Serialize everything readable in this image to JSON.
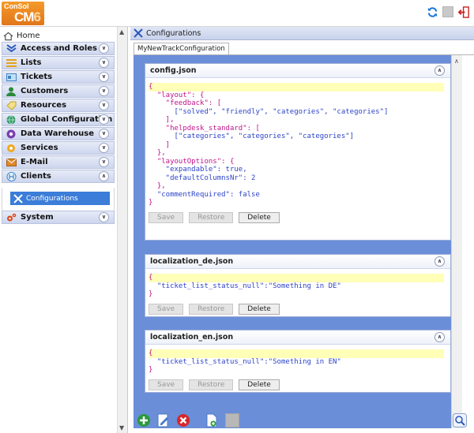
{
  "header": {
    "logo_small": "ConSol",
    "logo_big": "CM",
    "logo_version": "6",
    "refresh_icon": "refresh-icon",
    "logout_icon": "logout-icon"
  },
  "sidebar": {
    "home_label": "Home",
    "items": [
      {
        "label": "Access and Roles",
        "icon": "shield-icon"
      },
      {
        "label": "Lists",
        "icon": "list-icon"
      },
      {
        "label": "Tickets",
        "icon": "ticket-icon"
      },
      {
        "label": "Customers",
        "icon": "user-icon"
      },
      {
        "label": "Resources",
        "icon": "resource-icon"
      },
      {
        "label": "Global Configuration",
        "icon": "globe-icon"
      },
      {
        "label": "Data Warehouse",
        "icon": "warehouse-icon"
      },
      {
        "label": "Services",
        "icon": "services-icon"
      },
      {
        "label": "E-Mail",
        "icon": "mail-icon"
      },
      {
        "label": "Clients",
        "icon": "clients-icon"
      }
    ],
    "clients_sub": {
      "label": "Configurations"
    },
    "system_label": "System"
  },
  "main": {
    "title": "Configurations",
    "tab_label": "MyNewTrackConfiguration",
    "cards": [
      {
        "title": "config.json",
        "buttons": {
          "save": "Save",
          "restore": "Restore",
          "delete": "Delete"
        }
      },
      {
        "title": "localization_de.json",
        "line": "\"ticket_list_status_null\":\"Something in DE\"",
        "buttons": {
          "save": "Save",
          "restore": "Restore",
          "delete": "Delete"
        }
      },
      {
        "title": "localization_en.json",
        "line": "\"ticket_list_status_null\":\"Something in EN\"",
        "buttons": {
          "save": "Save",
          "restore": "Restore",
          "delete": "Delete"
        }
      }
    ],
    "config_json": {
      "l1": "{",
      "l2": "  \"layout\": {",
      "l3": "    \"feedback\": [",
      "l4": "      [\"solved\", \"friendly\", \"categories\", \"categories\"]",
      "l5": "    ],",
      "l6": "    \"helpdesk_standard\": [",
      "l7": "      [\"categories\", \"categories\", \"categories\"]",
      "l8": "    ]",
      "l9": "  },",
      "l10": "  \"layoutOptions\": {",
      "l11": "    \"expandable\": true,",
      "l12": "    \"defaultColumnsNr\": 2",
      "l13": "  },",
      "l14": "  \"commentRequired\": false",
      "l15": "}"
    }
  },
  "toolbar": {
    "icons": [
      "add-icon",
      "edit-icon",
      "delete-icon",
      "new-file-icon",
      "disabled-icon",
      "search-icon"
    ]
  },
  "colors": {
    "accent": "#3b7dd8",
    "content_bg": "#6b8ed8",
    "brand": "#e98a22"
  }
}
